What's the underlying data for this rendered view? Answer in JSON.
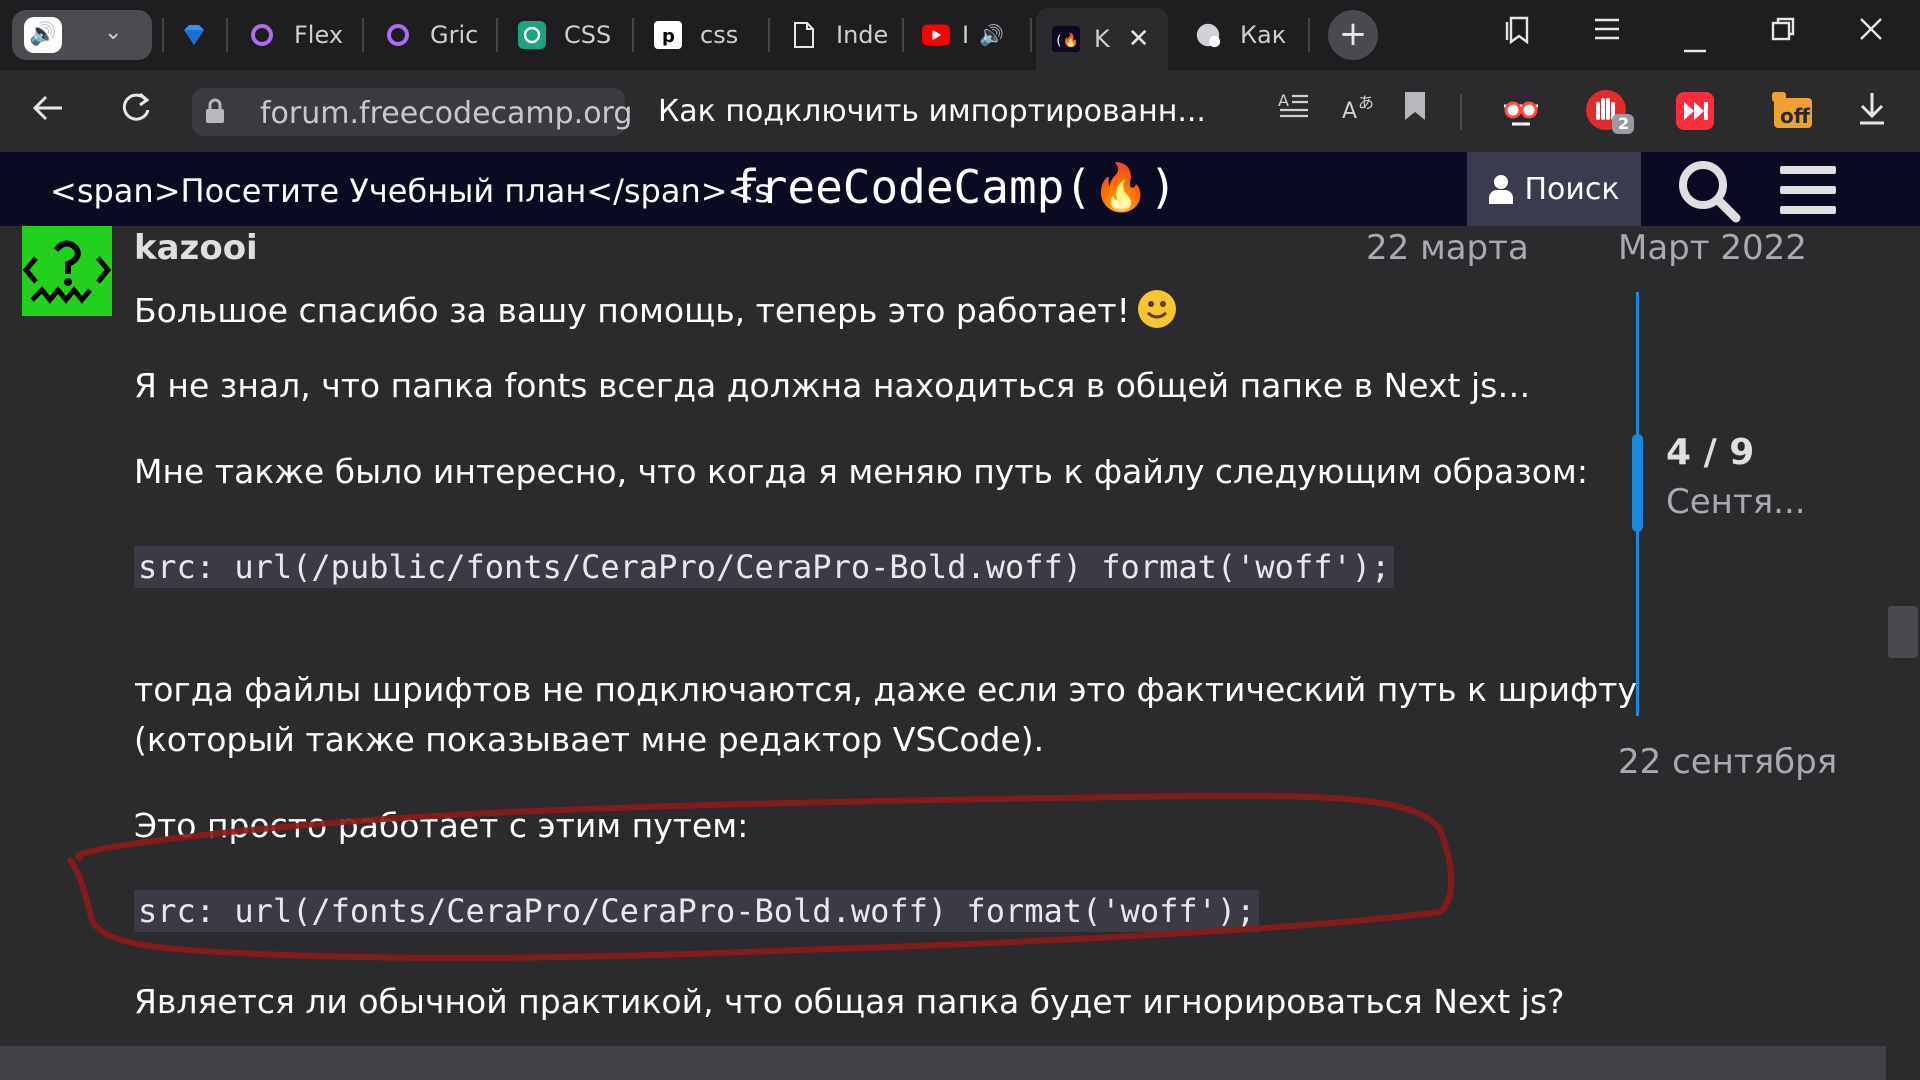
{
  "browser": {
    "tabs": [
      {
        "label": "Flex",
        "icon": "ring-icon"
      },
      {
        "label": "Gric",
        "icon": "ring-icon"
      },
      {
        "label": "CSS",
        "icon": "chatgpt-icon"
      },
      {
        "label": "css",
        "icon": "p-icon"
      },
      {
        "label": "Inde",
        "icon": "document-icon"
      },
      {
        "label": "I",
        "icon": "youtube-icon"
      },
      {
        "label": "K",
        "icon": "freecodecamp-icon",
        "active": true
      },
      {
        "label": "Как",
        "icon": "discourse-icon"
      }
    ],
    "address": {
      "domain": "forum.freecodecamp.org",
      "page_title": "Как подключить импортированн..."
    },
    "extension_badge_count": "2",
    "extension_off_label": "off"
  },
  "site": {
    "skip_text": "<span>Посетите Учебный план</span><s",
    "logo_text": "freeCodeCamp(🔥)",
    "search_label": "Поиск"
  },
  "post": {
    "author": "kazooi",
    "date": "22 марта",
    "paragraphs": [
      "Большое спасибо за вашу помощь, теперь это работает!",
      "Я не знал, что папка fonts всегда должна находиться в общей папке в Next js…",
      "Мне также было интересно, что когда я меняю путь к файлу следующим образом:",
      "тогда файлы шрифтов не подключаются, даже если это фактический путь к шрифту",
      "(который также показывает мне редактор VSCode).",
      "Это просто работает с этим путем:",
      "Является ли обычной практикой, что общая папка будет игнорироваться Next js?"
    ],
    "code_snippets": [
      "src: url(/public/fonts/CeraPro/CeraPro-Bold.woff) format('woff');",
      "src: url(/fonts/CeraPro/CeraPro-Bold.woff) format('woff');"
    ]
  },
  "timeline": {
    "top_label": "Март 2022",
    "position": "4 / 9",
    "position_date": "Сентя...",
    "bottom_label": "22 сентября"
  },
  "colors": {
    "accent_blue": "#1a8ad8",
    "header_bg": "#0a0a23",
    "annotation_red": "#8b1a1a"
  }
}
